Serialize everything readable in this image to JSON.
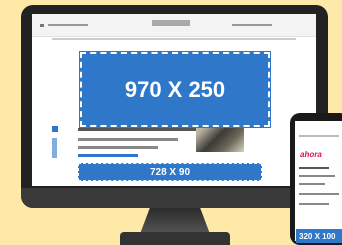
{
  "ad_sizes": {
    "billboard": "970 X 250",
    "leaderboard": "728 X 90",
    "mobile_banner": "320 X 100"
  },
  "phone": {
    "logo_text": "ahora"
  },
  "colors": {
    "background": "#ffe9a8",
    "ad_blue": "#2f77c9",
    "device": "#222222"
  }
}
